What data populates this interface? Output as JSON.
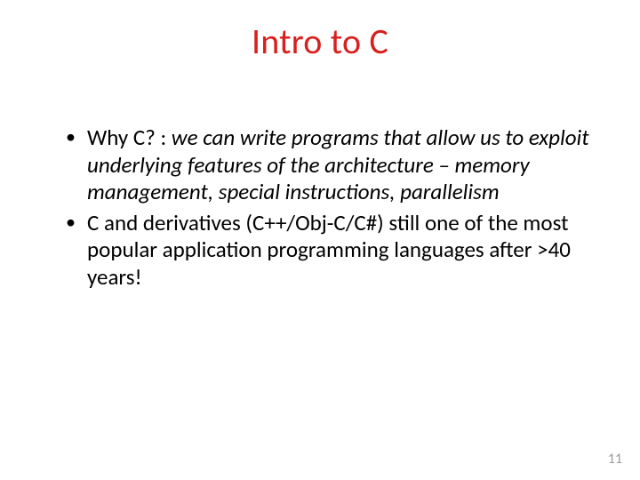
{
  "title": "Intro to C",
  "bullets": [
    {
      "lead": "Why C? : ",
      "italic": "we can write programs that allow us to exploit underlying features of the architecture – memory management, special instructions, parallelism"
    },
    {
      "lead": "",
      "italic": "",
      "plain": "C and derivatives (C++/Obj-C/C#) still one of the most popular application programming languages after >40 years!"
    }
  ],
  "page_number": "11"
}
